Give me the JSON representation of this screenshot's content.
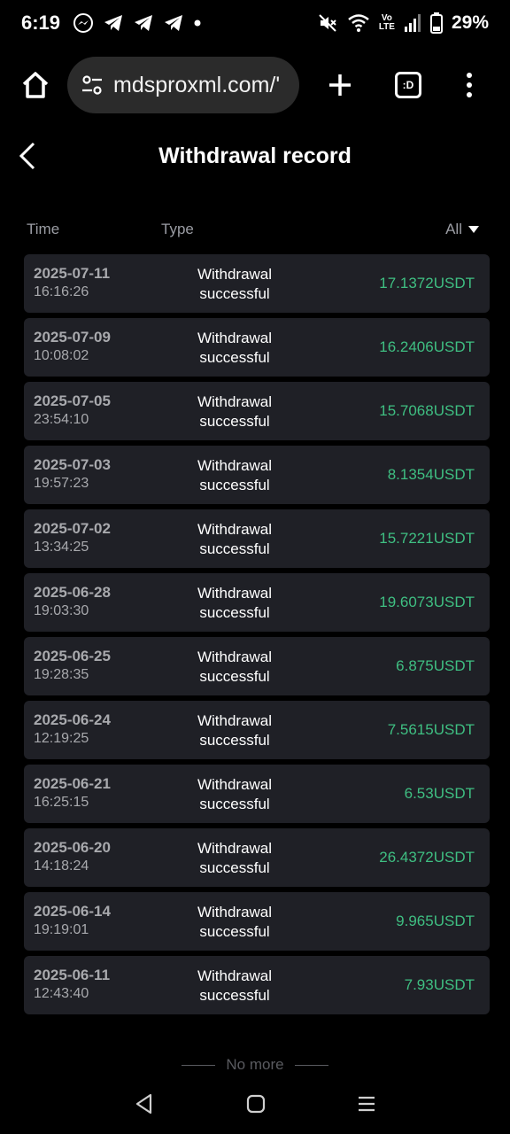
{
  "status_bar": {
    "time": "6:19",
    "battery": "29%",
    "notification_icons": [
      "messenger-icon",
      "telegram-icon",
      "telegram-icon",
      "telegram-icon"
    ],
    "system_icons": [
      "mute-icon",
      "wifi-icon",
      "volte-icon",
      "signal-icon",
      "battery-icon"
    ],
    "volte_label": "Vo\nLTE"
  },
  "browser": {
    "url": "mdsproxml.com/'",
    "tabs_label": ":D"
  },
  "page": {
    "title": "Withdrawal record"
  },
  "columns": {
    "time": "Time",
    "type": "Type",
    "filter": "All"
  },
  "records": [
    {
      "date": "2025-07-11",
      "time": "16:16:26",
      "type_line1": "Withdrawal",
      "type_line2": "successful",
      "amount": "17.1372USDT"
    },
    {
      "date": "2025-07-09",
      "time": "10:08:02",
      "type_line1": "Withdrawal",
      "type_line2": "successful",
      "amount": "16.2406USDT"
    },
    {
      "date": "2025-07-05",
      "time": "23:54:10",
      "type_line1": "Withdrawal",
      "type_line2": "successful",
      "amount": "15.7068USDT"
    },
    {
      "date": "2025-07-03",
      "time": "19:57:23",
      "type_line1": "Withdrawal",
      "type_line2": "successful",
      "amount": "8.1354USDT"
    },
    {
      "date": "2025-07-02",
      "time": "13:34:25",
      "type_line1": "Withdrawal",
      "type_line2": "successful",
      "amount": "15.7221USDT"
    },
    {
      "date": "2025-06-28",
      "time": "19:03:30",
      "type_line1": "Withdrawal",
      "type_line2": "successful",
      "amount": "19.6073USDT"
    },
    {
      "date": "2025-06-25",
      "time": "19:28:35",
      "type_line1": "Withdrawal",
      "type_line2": "successful",
      "amount": "6.875USDT"
    },
    {
      "date": "2025-06-24",
      "time": "12:19:25",
      "type_line1": "Withdrawal",
      "type_line2": "successful",
      "amount": "7.5615USDT"
    },
    {
      "date": "2025-06-21",
      "time": "16:25:15",
      "type_line1": "Withdrawal",
      "type_line2": "successful",
      "amount": "6.53USDT"
    },
    {
      "date": "2025-06-20",
      "time": "14:18:24",
      "type_line1": "Withdrawal",
      "type_line2": "successful",
      "amount": "26.4372USDT"
    },
    {
      "date": "2025-06-14",
      "time": "19:19:01",
      "type_line1": "Withdrawal",
      "type_line2": "successful",
      "amount": "9.965USDT"
    },
    {
      "date": "2025-06-11",
      "time": "12:43:40",
      "type_line1": "Withdrawal",
      "type_line2": "successful",
      "amount": "7.93USDT"
    }
  ],
  "footer": {
    "no_more": "No more"
  },
  "colors": {
    "background": "#000000",
    "row_background": "#1f2026",
    "amount": "#3fbf82",
    "muted_text": "#9a9ca3"
  }
}
